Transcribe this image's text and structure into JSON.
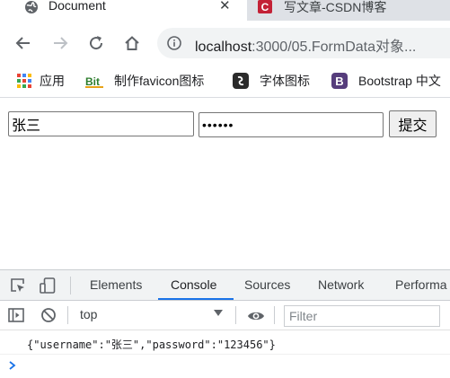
{
  "browser": {
    "tabs": [
      {
        "title": "Document",
        "active": true,
        "favicon": "globe-icon"
      },
      {
        "title": "写文章-CSDN博客",
        "active": false,
        "favicon": "csdn-icon"
      }
    ],
    "url": {
      "host": "localhost",
      "path": ":3000/05.FormData对象..."
    },
    "bookmarks": [
      {
        "label": "应用",
        "icon": "apps-grid-icon"
      },
      {
        "label": "制作favicon图标",
        "icon": "bitbug-icon"
      },
      {
        "label": "字体图标",
        "icon": "iconfont-icon"
      },
      {
        "label": "Bootstrap 中文",
        "icon": "bootstrap-icon"
      }
    ]
  },
  "form": {
    "username_value": "张三",
    "password_value": "123456",
    "submit_label": "提交"
  },
  "devtools": {
    "tabs": [
      {
        "label": "Elements",
        "active": false
      },
      {
        "label": "Console",
        "active": true
      },
      {
        "label": "Sources",
        "active": false
      },
      {
        "label": "Network",
        "active": false
      },
      {
        "label": "Performa",
        "active": false
      }
    ],
    "context": "top",
    "filter_placeholder": "Filter",
    "log": "{\"username\":\"张三\",\"password\":\"123456\"}"
  },
  "colors": {
    "tabstrip_bg": "#dee1e6",
    "accent_blue": "#1a73e8",
    "csdn_red": "#c32136",
    "bootstrap_purple": "#563d7c"
  }
}
